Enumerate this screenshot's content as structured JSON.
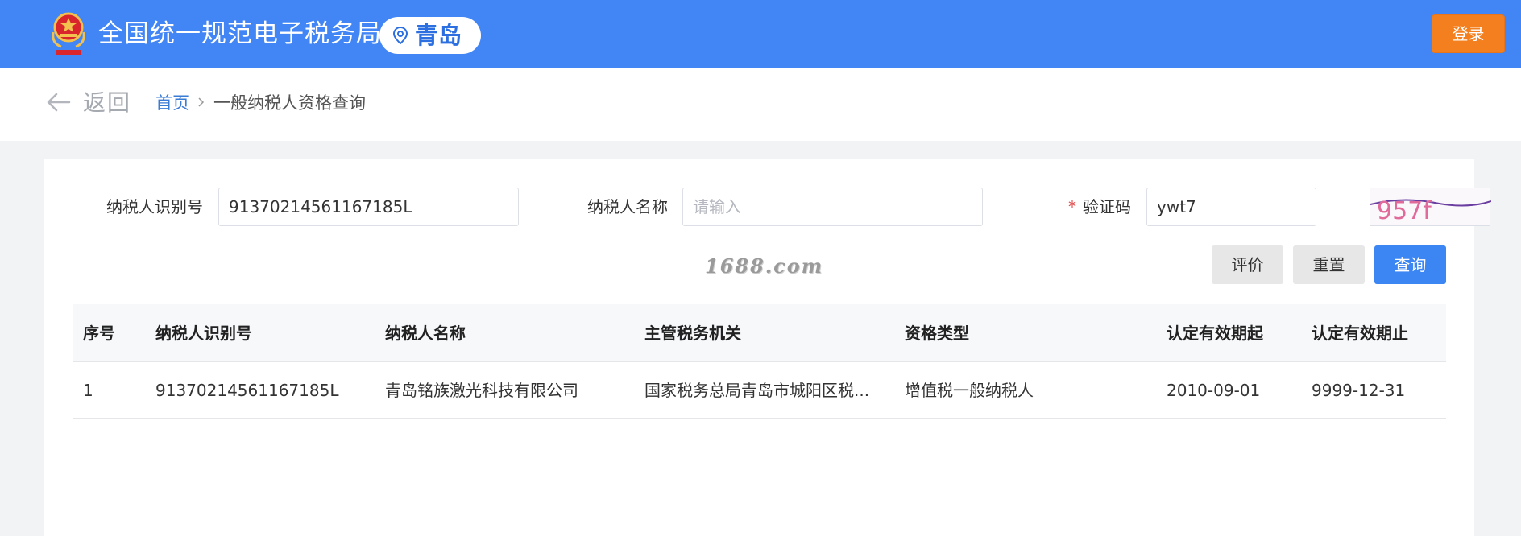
{
  "header": {
    "site_title": "全国统一规范电子税务局",
    "city": "青岛",
    "login_label": "登录",
    "emblem_icon": "national-emblem-icon",
    "location_icon": "location-pin-icon"
  },
  "nav": {
    "back_label": "返回",
    "breadcrumb_home": "首页",
    "breadcrumb_current": "一般纳税人资格查询",
    "back_icon": "arrow-left-icon",
    "separator_icon": "chevron-right-icon"
  },
  "form": {
    "taxpayer_id_label": "纳税人识别号",
    "taxpayer_id_value": "91370214561167185L",
    "taxpayer_name_label": "纳税人名称",
    "taxpayer_name_placeholder": "请输入",
    "captcha_required_mark": "*",
    "captcha_label": "验证码",
    "captcha_value": "ywt7",
    "captcha_image_text": "957f"
  },
  "buttons": {
    "evaluate": "评价",
    "reset": "重置",
    "query": "查询"
  },
  "watermark": "1688.com",
  "table": {
    "headers": [
      "序号",
      "纳税人识别号",
      "纳税人名称",
      "主管税务机关",
      "资格类型",
      "认定有效期起",
      "认定有效期止"
    ],
    "rows": [
      [
        "1",
        "91370214561167185L",
        "青岛铭族激光科技有限公司",
        "国家税务总局青岛市城阳区税...",
        "增值税一般纳税人",
        "2010-09-01",
        "9999-12-31"
      ]
    ]
  },
  "colors": {
    "header_bg": "#4285f4",
    "login_bg": "#f47f1f",
    "primary": "#3c86f4",
    "link": "#3a7bd5",
    "required": "#e14b4b"
  }
}
